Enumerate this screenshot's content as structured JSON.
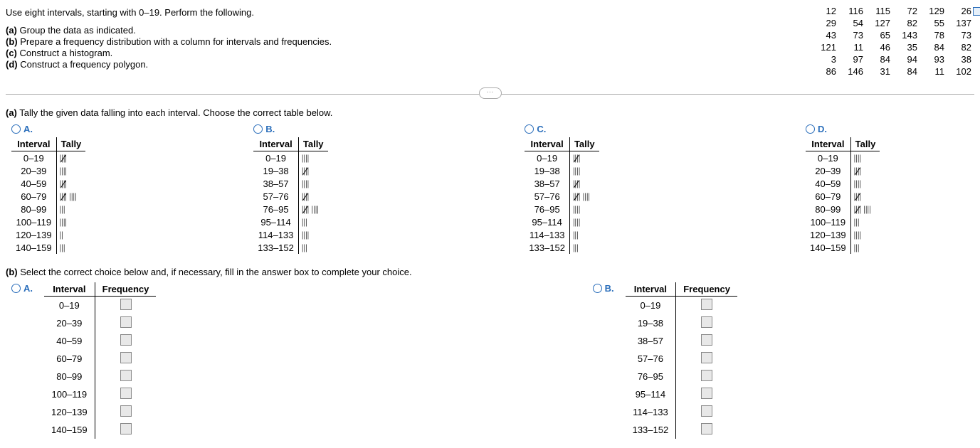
{
  "instruction": "Use eight intervals, starting with 0–19. Perform the following.",
  "parts": {
    "a_label": "(a)",
    "a_text": "Group the data as indicated.",
    "b_label": "(b)",
    "b_text": "Prepare a frequency distribution with a column for intervals and frequencies.",
    "c_label": "(c)",
    "c_text": "Construct a histogram.",
    "d_label": "(d)",
    "d_text": "Construct a frequency polygon."
  },
  "data_values": [
    [
      12,
      116,
      115,
      72,
      129,
      26
    ],
    [
      29,
      54,
      127,
      82,
      55,
      137
    ],
    [
      43,
      73,
      65,
      143,
      78,
      73
    ],
    [
      121,
      11,
      46,
      35,
      84,
      82
    ],
    [
      3,
      97,
      84,
      94,
      93,
      38
    ],
    [
      86,
      146,
      31,
      84,
      11,
      102
    ]
  ],
  "divider_toggle": "···",
  "section_a_prompt_label": "(a)",
  "section_a_prompt_text": "Tally the given data falling into each interval. Choose the correct table below.",
  "headers": {
    "interval": "Interval",
    "tally": "Tally",
    "frequency": "Frequency"
  },
  "options_a": {
    "A": {
      "label": "A.",
      "rows": [
        {
          "interval": "0–19",
          "tally": "5"
        },
        {
          "interval": "20–39",
          "tally": "4"
        },
        {
          "interval": "40–59",
          "tally": "5"
        },
        {
          "interval": "60–79",
          "tally": "9"
        },
        {
          "interval": "80–99",
          "tally": "3"
        },
        {
          "interval": "100–119",
          "tally": "4"
        },
        {
          "interval": "120–139",
          "tally": "2"
        },
        {
          "interval": "140–159",
          "tally": "3"
        }
      ]
    },
    "B": {
      "label": "B.",
      "rows": [
        {
          "interval": "0–19",
          "tally": "4"
        },
        {
          "interval": "19–38",
          "tally": "5"
        },
        {
          "interval": "38–57",
          "tally": "4"
        },
        {
          "interval": "57–76",
          "tally": "5"
        },
        {
          "interval": "76–95",
          "tally": "9"
        },
        {
          "interval": "95–114",
          "tally": "3"
        },
        {
          "interval": "114–133",
          "tally": "4"
        },
        {
          "interval": "133–152",
          "tally": "3"
        }
      ]
    },
    "C": {
      "label": "C.",
      "rows": [
        {
          "interval": "0–19",
          "tally": "5"
        },
        {
          "interval": "19–38",
          "tally": "4"
        },
        {
          "interval": "38–57",
          "tally": "5"
        },
        {
          "interval": "57–76",
          "tally": "9"
        },
        {
          "interval": "76–95",
          "tally": "4"
        },
        {
          "interval": "95–114",
          "tally": "4"
        },
        {
          "interval": "114–133",
          "tally": "3"
        },
        {
          "interval": "133–152",
          "tally": "3"
        }
      ]
    },
    "D": {
      "label": "D.",
      "rows": [
        {
          "interval": "0–19",
          "tally": "4"
        },
        {
          "interval": "20–39",
          "tally": "5"
        },
        {
          "interval": "40–59",
          "tally": "4"
        },
        {
          "interval": "60–79",
          "tally": "5"
        },
        {
          "interval": "80–99",
          "tally": "9"
        },
        {
          "interval": "100–119",
          "tally": "3"
        },
        {
          "interval": "120–139",
          "tally": "4"
        },
        {
          "interval": "140–159",
          "tally": "3"
        }
      ]
    }
  },
  "section_b_prompt_label": "(b)",
  "section_b_prompt_text": "Select the correct choice below and, if necessary, fill in the answer box to complete your choice.",
  "options_b": {
    "A": {
      "label": "A.",
      "intervals": [
        "0–19",
        "20–39",
        "40–59",
        "60–79",
        "80–99",
        "100–119",
        "120–139",
        "140–159"
      ]
    },
    "B": {
      "label": "B.",
      "intervals": [
        "0–19",
        "19–38",
        "38–57",
        "57–76",
        "76–95",
        "95–114",
        "114–133",
        "133–152"
      ]
    }
  }
}
